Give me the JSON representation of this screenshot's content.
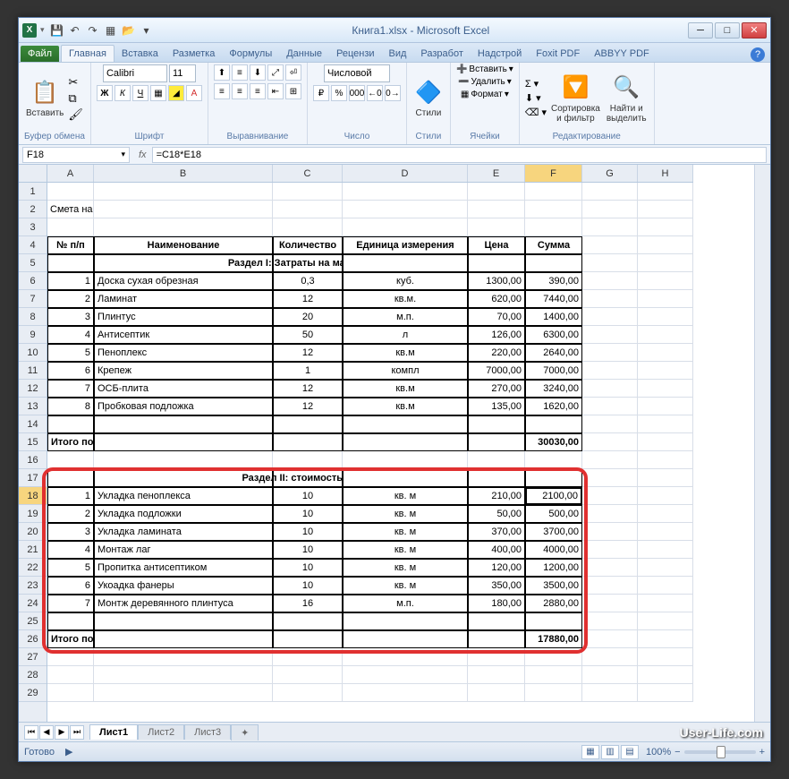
{
  "title": "Книга1.xlsx - Microsoft Excel",
  "tabs": {
    "file": "Файл",
    "home": "Главная",
    "insert": "Вставка",
    "layout": "Разметка",
    "formulas": "Формулы",
    "data": "Данные",
    "review": "Рецензи",
    "view": "Вид",
    "dev": "Разработ",
    "addins": "Надстрой",
    "foxit": "Foxit PDF",
    "abbyy": "ABBYY PDF"
  },
  "ribbon": {
    "clipboard": {
      "label": "Буфер обмена",
      "paste": "Вставить"
    },
    "font": {
      "label": "Шрифт",
      "name": "Calibri",
      "size": "11"
    },
    "align": {
      "label": "Выравнивание"
    },
    "number": {
      "label": "Число",
      "format": "Числовой"
    },
    "styles": {
      "label": "Стили",
      "btn": "Стили"
    },
    "cells": {
      "label": "Ячейки",
      "insert": "Вставить",
      "delete": "Удалить",
      "format": "Формат"
    },
    "editing": {
      "label": "Редактирование",
      "sort": "Сортировка\nи фильтр",
      "find": "Найти и\nвыделить"
    }
  },
  "namebox": "F18",
  "formula": "=C18*E18",
  "columns": [
    "A",
    "B",
    "C",
    "D",
    "E",
    "F",
    "G",
    "H"
  ],
  "doc_title": "Смета на работы",
  "headers": {
    "n": "№ п/п",
    "name": "Наименование",
    "qty": "Количество",
    "unit": "Единица измерения",
    "price": "Цена",
    "sum": "Сумма"
  },
  "section1": {
    "title": "Раздел I: Затраты на материалы",
    "total_label": "Итого по материалам",
    "total": "30030,00",
    "rows": [
      {
        "n": "1",
        "name": "Доска сухая обрезная",
        "qty": "0,3",
        "unit": "куб.",
        "price": "1300,00",
        "sum": "390,00"
      },
      {
        "n": "2",
        "name": "Ламинат",
        "qty": "12",
        "unit": "кв.м.",
        "price": "620,00",
        "sum": "7440,00"
      },
      {
        "n": "3",
        "name": "Плинтус",
        "qty": "20",
        "unit": "м.п.",
        "price": "70,00",
        "sum": "1400,00"
      },
      {
        "n": "4",
        "name": "Антисептик",
        "qty": "50",
        "unit": "л",
        "price": "126,00",
        "sum": "6300,00"
      },
      {
        "n": "5",
        "name": "Пеноплекс",
        "qty": "12",
        "unit": "кв.м",
        "price": "220,00",
        "sum": "2640,00"
      },
      {
        "n": "6",
        "name": "Крепеж",
        "qty": "1",
        "unit": "компл",
        "price": "7000,00",
        "sum": "7000,00"
      },
      {
        "n": "7",
        "name": "ОСБ-плита",
        "qty": "12",
        "unit": "кв.м",
        "price": "270,00",
        "sum": "3240,00"
      },
      {
        "n": "8",
        "name": "Пробковая подложка",
        "qty": "12",
        "unit": "кв.м",
        "price": "135,00",
        "sum": "1620,00"
      }
    ]
  },
  "section2": {
    "title": "Раздел II: стоимость работ",
    "total_label": "Итого по стоимости работ",
    "total": "17880,00",
    "rows": [
      {
        "n": "1",
        "name": "Укладка пеноплекса",
        "qty": "10",
        "unit": "кв. м",
        "price": "210,00",
        "sum": "2100,00"
      },
      {
        "n": "2",
        "name": "Укладка подложки",
        "qty": "10",
        "unit": "кв. м",
        "price": "50,00",
        "sum": "500,00"
      },
      {
        "n": "3",
        "name": "Укладка  ламината",
        "qty": "10",
        "unit": "кв. м",
        "price": "370,00",
        "sum": "3700,00"
      },
      {
        "n": "4",
        "name": "Монтаж лаг",
        "qty": "10",
        "unit": "кв. м",
        "price": "400,00",
        "sum": "4000,00"
      },
      {
        "n": "5",
        "name": "Пропитка антисептиком",
        "qty": "10",
        "unit": "кв. м",
        "price": "120,00",
        "sum": "1200,00"
      },
      {
        "n": "6",
        "name": "Укоадка фанеры",
        "qty": "10",
        "unit": "кв. м",
        "price": "350,00",
        "sum": "3500,00"
      },
      {
        "n": "7",
        "name": "Монтж деревянного плинтуса",
        "qty": "16",
        "unit": "м.п.",
        "price": "180,00",
        "sum": "2880,00"
      }
    ]
  },
  "sheets": [
    "Лист1",
    "Лист2",
    "Лист3"
  ],
  "status": "Готово",
  "zoom": "100%",
  "watermark": "User-Life.com",
  "chart_data": {
    "type": "table",
    "title": "Смета на работы",
    "sections": [
      {
        "name": "Раздел I: Затраты на материалы",
        "total": 30030.0,
        "rows": [
          [
            "Доска сухая обрезная",
            0.3,
            "куб.",
            1300.0,
            390.0
          ],
          [
            "Ламинат",
            12,
            "кв.м.",
            620.0,
            7440.0
          ],
          [
            "Плинтус",
            20,
            "м.п.",
            70.0,
            1400.0
          ],
          [
            "Антисептик",
            50,
            "л",
            126.0,
            6300.0
          ],
          [
            "Пеноплекс",
            12,
            "кв.м",
            220.0,
            2640.0
          ],
          [
            "Крепеж",
            1,
            "компл",
            7000.0,
            7000.0
          ],
          [
            "ОСБ-плита",
            12,
            "кв.м",
            270.0,
            3240.0
          ],
          [
            "Пробковая подложка",
            12,
            "кв.м",
            135.0,
            1620.0
          ]
        ]
      },
      {
        "name": "Раздел II: стоимость работ",
        "total": 17880.0,
        "rows": [
          [
            "Укладка пеноплекса",
            10,
            "кв. м",
            210.0,
            2100.0
          ],
          [
            "Укладка подложки",
            10,
            "кв. м",
            50.0,
            500.0
          ],
          [
            "Укладка  ламината",
            10,
            "кв. м",
            370.0,
            3700.0
          ],
          [
            "Монтаж лаг",
            10,
            "кв. м",
            400.0,
            4000.0
          ],
          [
            "Пропитка антисептиком",
            10,
            "кв. м",
            120.0,
            1200.0
          ],
          [
            "Укоадка фанеры",
            10,
            "кв. м",
            350.0,
            3500.0
          ],
          [
            "Монтж деревянного плинтуса",
            16,
            "м.п.",
            180.0,
            2880.0
          ]
        ]
      }
    ]
  }
}
